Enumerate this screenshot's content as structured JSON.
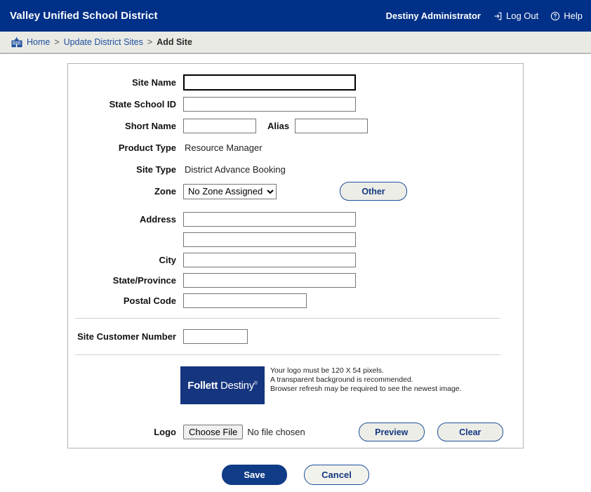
{
  "header": {
    "district_title": "Valley Unified School District",
    "user_name": "Destiny Administrator",
    "logout_label": "Log Out",
    "help_label": "Help",
    "bg_color": "#003087"
  },
  "breadcrumb": {
    "home_label": "Home",
    "sep1": ">",
    "parent_label": "Update District Sites",
    "sep2": ">",
    "current_label": "Add Site"
  },
  "form": {
    "site_name": {
      "label": "Site Name",
      "value": "",
      "focused": true
    },
    "state_school_id": {
      "label": "State School ID",
      "value": ""
    },
    "short_name": {
      "label": "Short Name",
      "value": ""
    },
    "alias": {
      "label": "Alias",
      "value": ""
    },
    "product_type": {
      "label": "Product Type",
      "value": "Resource Manager"
    },
    "site_type": {
      "label": "Site Type",
      "value": "District Advance Booking"
    },
    "zone": {
      "label": "Zone",
      "selected": "No Zone Assigned",
      "options": [
        "No Zone Assigned"
      ]
    },
    "other_button": "Other",
    "address": {
      "label": "Address",
      "line1": "",
      "line2": ""
    },
    "city": {
      "label": "City",
      "value": ""
    },
    "state_province": {
      "label": "State/Province",
      "value": ""
    },
    "postal_code": {
      "label": "Postal Code",
      "value": ""
    },
    "site_customer_number": {
      "label": "Site Customer Number",
      "value": ""
    }
  },
  "logo_section": {
    "label": "Logo",
    "image_brand_bold": "Follett",
    "image_brand_light": "Destiny",
    "image_registered": "®",
    "note_line1": "Your logo must be 120 X 54 pixels.",
    "note_line2": "A transparent background is recommended.",
    "note_line3": "Browser refresh may be required to see the newest image.",
    "choose_file_label": "Choose File",
    "no_file_label": "No file chosen",
    "preview_button": "Preview",
    "clear_button": "Clear"
  },
  "footer": {
    "save_label": "Save",
    "cancel_label": "Cancel"
  }
}
